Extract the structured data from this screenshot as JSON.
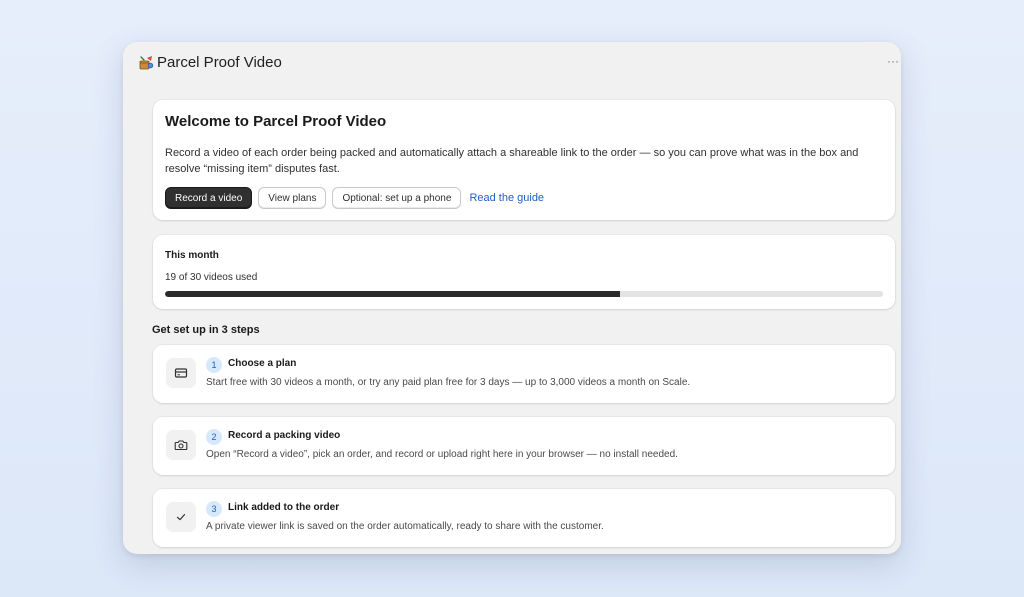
{
  "app": {
    "title": "Parcel Proof Video",
    "logo_icon": "parcel-logo-icon",
    "more_label": "···"
  },
  "welcome": {
    "heading": "Welcome to Parcel Proof Video",
    "description": "Record a video of each order being packed and automatically attach a shareable link to the order — so you can prove what was in the box and resolve “missing item” disputes fast.",
    "buttons": {
      "record": "Record a video",
      "plans": "View plans",
      "phone": "Optional: set up a phone"
    },
    "guide_link": "Read the guide"
  },
  "usage": {
    "label": "This month",
    "count_text": "19 of 30 videos used",
    "used": 19,
    "limit": 30
  },
  "setup": {
    "title": "Get set up in 3 steps",
    "steps": [
      {
        "number": "1",
        "title": "Choose a plan",
        "description": "Start free with 30 videos a month, or try any paid plan free for 3 days — up to 3,000 videos a month on Scale.",
        "icon": "credit-card-icon"
      },
      {
        "number": "2",
        "title": "Record a packing video",
        "description": "Open “Record a video”, pick an order, and record or upload right here in your browser — no install needed.",
        "icon": "camera-icon"
      },
      {
        "number": "3",
        "title": "Link added to the order",
        "description": "A private viewer link is saved on the order automatically, ready to share with the customer.",
        "icon": "checkmark-icon"
      }
    ]
  },
  "colors": {
    "primary_button": "#303030",
    "link": "#1f5fc5",
    "progress_fill": "#2b2b2b",
    "step_badge_bg": "#d6e8fb"
  }
}
